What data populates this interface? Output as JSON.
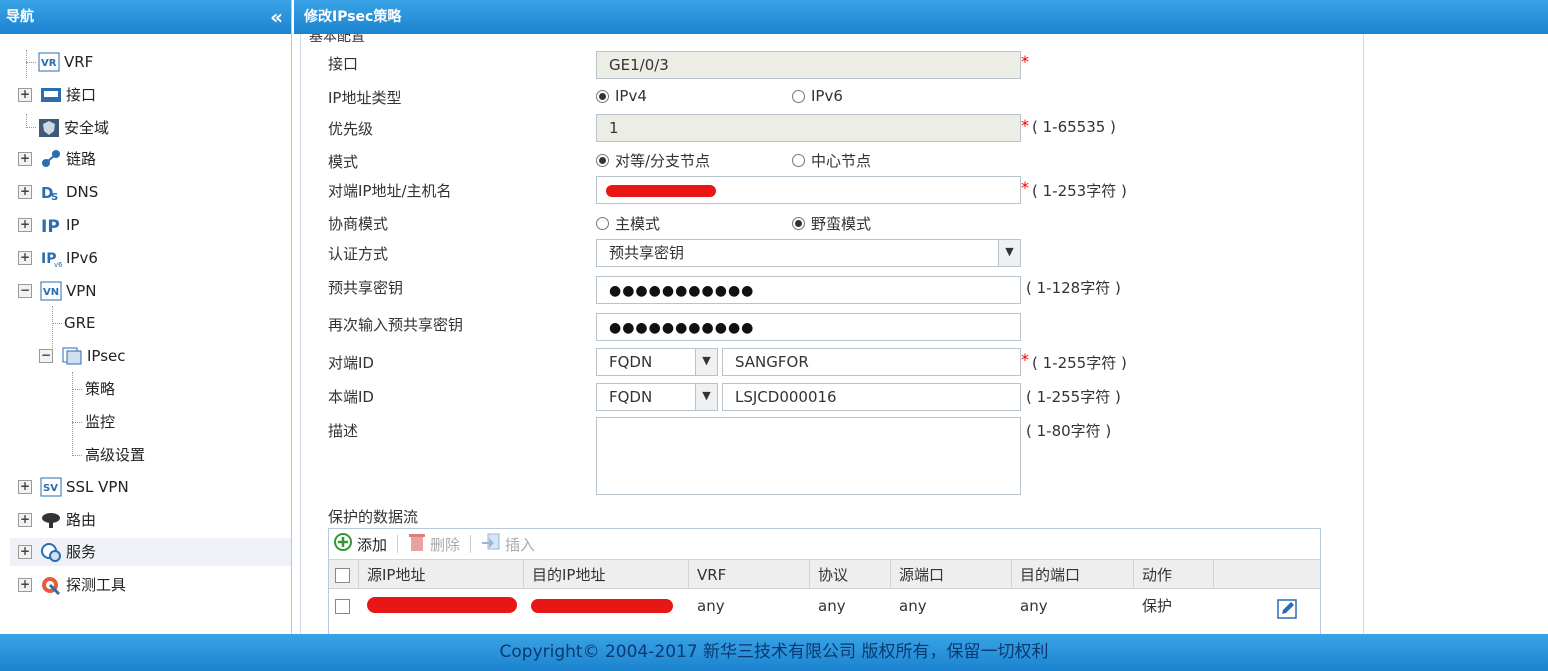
{
  "nav": {
    "title": "导航",
    "collapse_icon": "«",
    "items": [
      {
        "label": "VRF"
      },
      {
        "label": "接口"
      },
      {
        "label": "安全域"
      },
      {
        "label": "链路"
      },
      {
        "label": "DNS"
      },
      {
        "label": "IP"
      },
      {
        "label": "IPv6"
      },
      {
        "label": "VPN"
      },
      {
        "label": "GRE"
      },
      {
        "label": "IPsec"
      },
      {
        "label": "策略"
      },
      {
        "label": "监控"
      },
      {
        "label": "高级设置"
      },
      {
        "label": "SSL VPN"
      },
      {
        "label": "路由"
      },
      {
        "label": "服务"
      },
      {
        "label": "探测工具"
      }
    ]
  },
  "page": {
    "title": "修改IPsec策略",
    "section_title": "基本配置"
  },
  "form": {
    "interface": {
      "label": "接口",
      "value": "GE1/0/3"
    },
    "ip_type": {
      "label": "IP地址类型",
      "option1": "IPv4",
      "option2": "IPv6",
      "selected": "IPv4"
    },
    "priority": {
      "label": "优先级",
      "value": "1",
      "hint": "( 1-65535 )"
    },
    "mode": {
      "label": "模式",
      "option1": "对等/分支节点",
      "option2": "中心节点",
      "selected": "对等/分支节点"
    },
    "peer_ip": {
      "label": "对端IP地址/主机名",
      "value": "",
      "hint": "( 1-253字符 )"
    },
    "negotiation": {
      "label": "协商模式",
      "option1": "主模式",
      "option2": "野蛮模式",
      "selected": "野蛮模式"
    },
    "auth": {
      "label": "认证方式",
      "value": "预共享密钥"
    },
    "psk": {
      "label": "预共享密钥",
      "value": "●●●●●●●●●●●",
      "hint": "( 1-128字符 )"
    },
    "psk_confirm": {
      "label": "再次输入预共享密钥",
      "value": "●●●●●●●●●●●"
    },
    "peer_id": {
      "label": "对端ID",
      "type": "FQDN",
      "value": "SANGFOR",
      "hint": "( 1-255字符 )"
    },
    "local_id": {
      "label": "本端ID",
      "type": "FQDN",
      "value": "LSJCD000016",
      "hint": "( 1-255字符 )"
    },
    "desc": {
      "label": "描述",
      "hint": "( 1-80字符 )"
    },
    "required_mark": "*"
  },
  "flows": {
    "title": "保护的数据流",
    "toolbar": {
      "add": "添加",
      "delete": "删除",
      "insert": "插入"
    },
    "columns": [
      "源IP地址",
      "目的IP地址",
      "VRF",
      "协议",
      "源端口",
      "目的端口",
      "动作"
    ],
    "rows": [
      {
        "src": "",
        "dst": "",
        "vrf": "any",
        "proto": "any",
        "sport": "any",
        "dport": "any",
        "action": "保护"
      }
    ]
  },
  "footer": {
    "text": "Copyright© 2004-2017 新华三技术有限公司 版权所有，保留一切权利"
  },
  "colors": {
    "header_blue": "#1c83cf",
    "required_red": "#e00000",
    "redaction_red": "#e91616"
  }
}
